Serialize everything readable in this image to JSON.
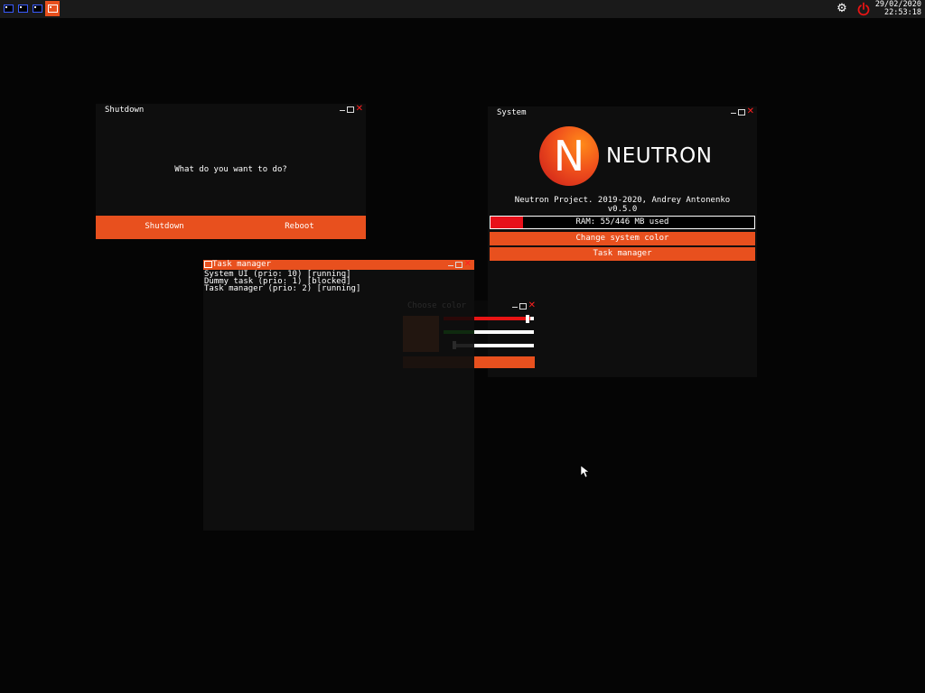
{
  "taskbar": {
    "apps": [
      {
        "name": "app-1"
      },
      {
        "name": "app-2"
      },
      {
        "name": "app-3"
      },
      {
        "name": "task-manager",
        "active": true
      }
    ],
    "date": "29/02/2020",
    "time": "22:53:18"
  },
  "shutdown_window": {
    "title": "Shutdown",
    "question": "What do you want to do?",
    "shutdown_label": "Shutdown",
    "reboot_label": "Reboot"
  },
  "system_window": {
    "title": "System",
    "logo_text": "NEUTRON",
    "logo_letter": "N",
    "credits": "Neutron Project. 2019-2020, Andrey Antonenko",
    "version": "v0.5.0",
    "ram_label": "RAM: 55/446 MB used",
    "ram_used_mb": 55,
    "ram_total_mb": 446,
    "change_color_label": "Change system color",
    "task_manager_label": "Task manager"
  },
  "task_manager_window": {
    "title": "Task manager",
    "tasks": [
      "System UI (prio: 10) [running]",
      "Dummy task (prio: 1) [blocked]",
      "Task manager (prio: 2) [running]"
    ]
  },
  "color_window": {
    "title": "Choose color",
    "apply_label": ""
  },
  "colors": {
    "accent": "#e8501e",
    "ram_fill": "#e8101a",
    "close": "#ff2020"
  }
}
